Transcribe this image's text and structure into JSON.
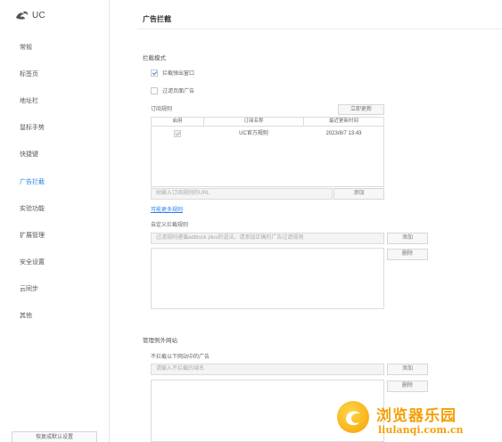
{
  "sidebar": {
    "logo_text": "UC",
    "items": [
      {
        "label": "常规"
      },
      {
        "label": "标签页"
      },
      {
        "label": "地址栏"
      },
      {
        "label": "鼠标手势"
      },
      {
        "label": "快捷键"
      },
      {
        "label": "广告拦截",
        "active": true
      },
      {
        "label": "实验功能"
      },
      {
        "label": "扩展管理"
      },
      {
        "label": "安全设置"
      },
      {
        "label": "云同步"
      },
      {
        "label": "其他"
      }
    ],
    "restore_button": "恢复成默认设置"
  },
  "main": {
    "title": "广告拦截",
    "block_mode": {
      "title": "拦截模式",
      "block_popups": {
        "label": "拦截弹出窗口",
        "checked": true
      },
      "filter_page_ads": {
        "label": "过滤页面广告",
        "checked": false
      }
    },
    "subscription": {
      "label": "订阅规则",
      "update_button": "立即更新",
      "columns": [
        "启用",
        "订阅名称",
        "最近更新时间"
      ],
      "rows": [
        {
          "enabled": true,
          "name": "UC官方规则",
          "updated": "2023/8/7 13:43"
        }
      ],
      "url_placeholder": "贴输入订阅规则的URL",
      "add_button": "添加",
      "more_link": "可能更多规则"
    },
    "custom_filter": {
      "title": "自定义拦截规则",
      "placeholder": "过滤规则遵循adblock plus的语法，请添加正确的广告过滤规则",
      "add_button": "添加",
      "delete_button": "删除"
    },
    "exceptions": {
      "title": "管理例外网站",
      "label": "不拦截以下网站中的广告",
      "placeholder": "请输入不拦截的域名",
      "add_button": "添加",
      "delete_button": "删除"
    }
  },
  "watermark": {
    "title": "浏览器乐园",
    "url": "liulanqi.com.cn"
  },
  "colors": {
    "accent": "#2f80ed",
    "watermark": "#f3a10a"
  }
}
